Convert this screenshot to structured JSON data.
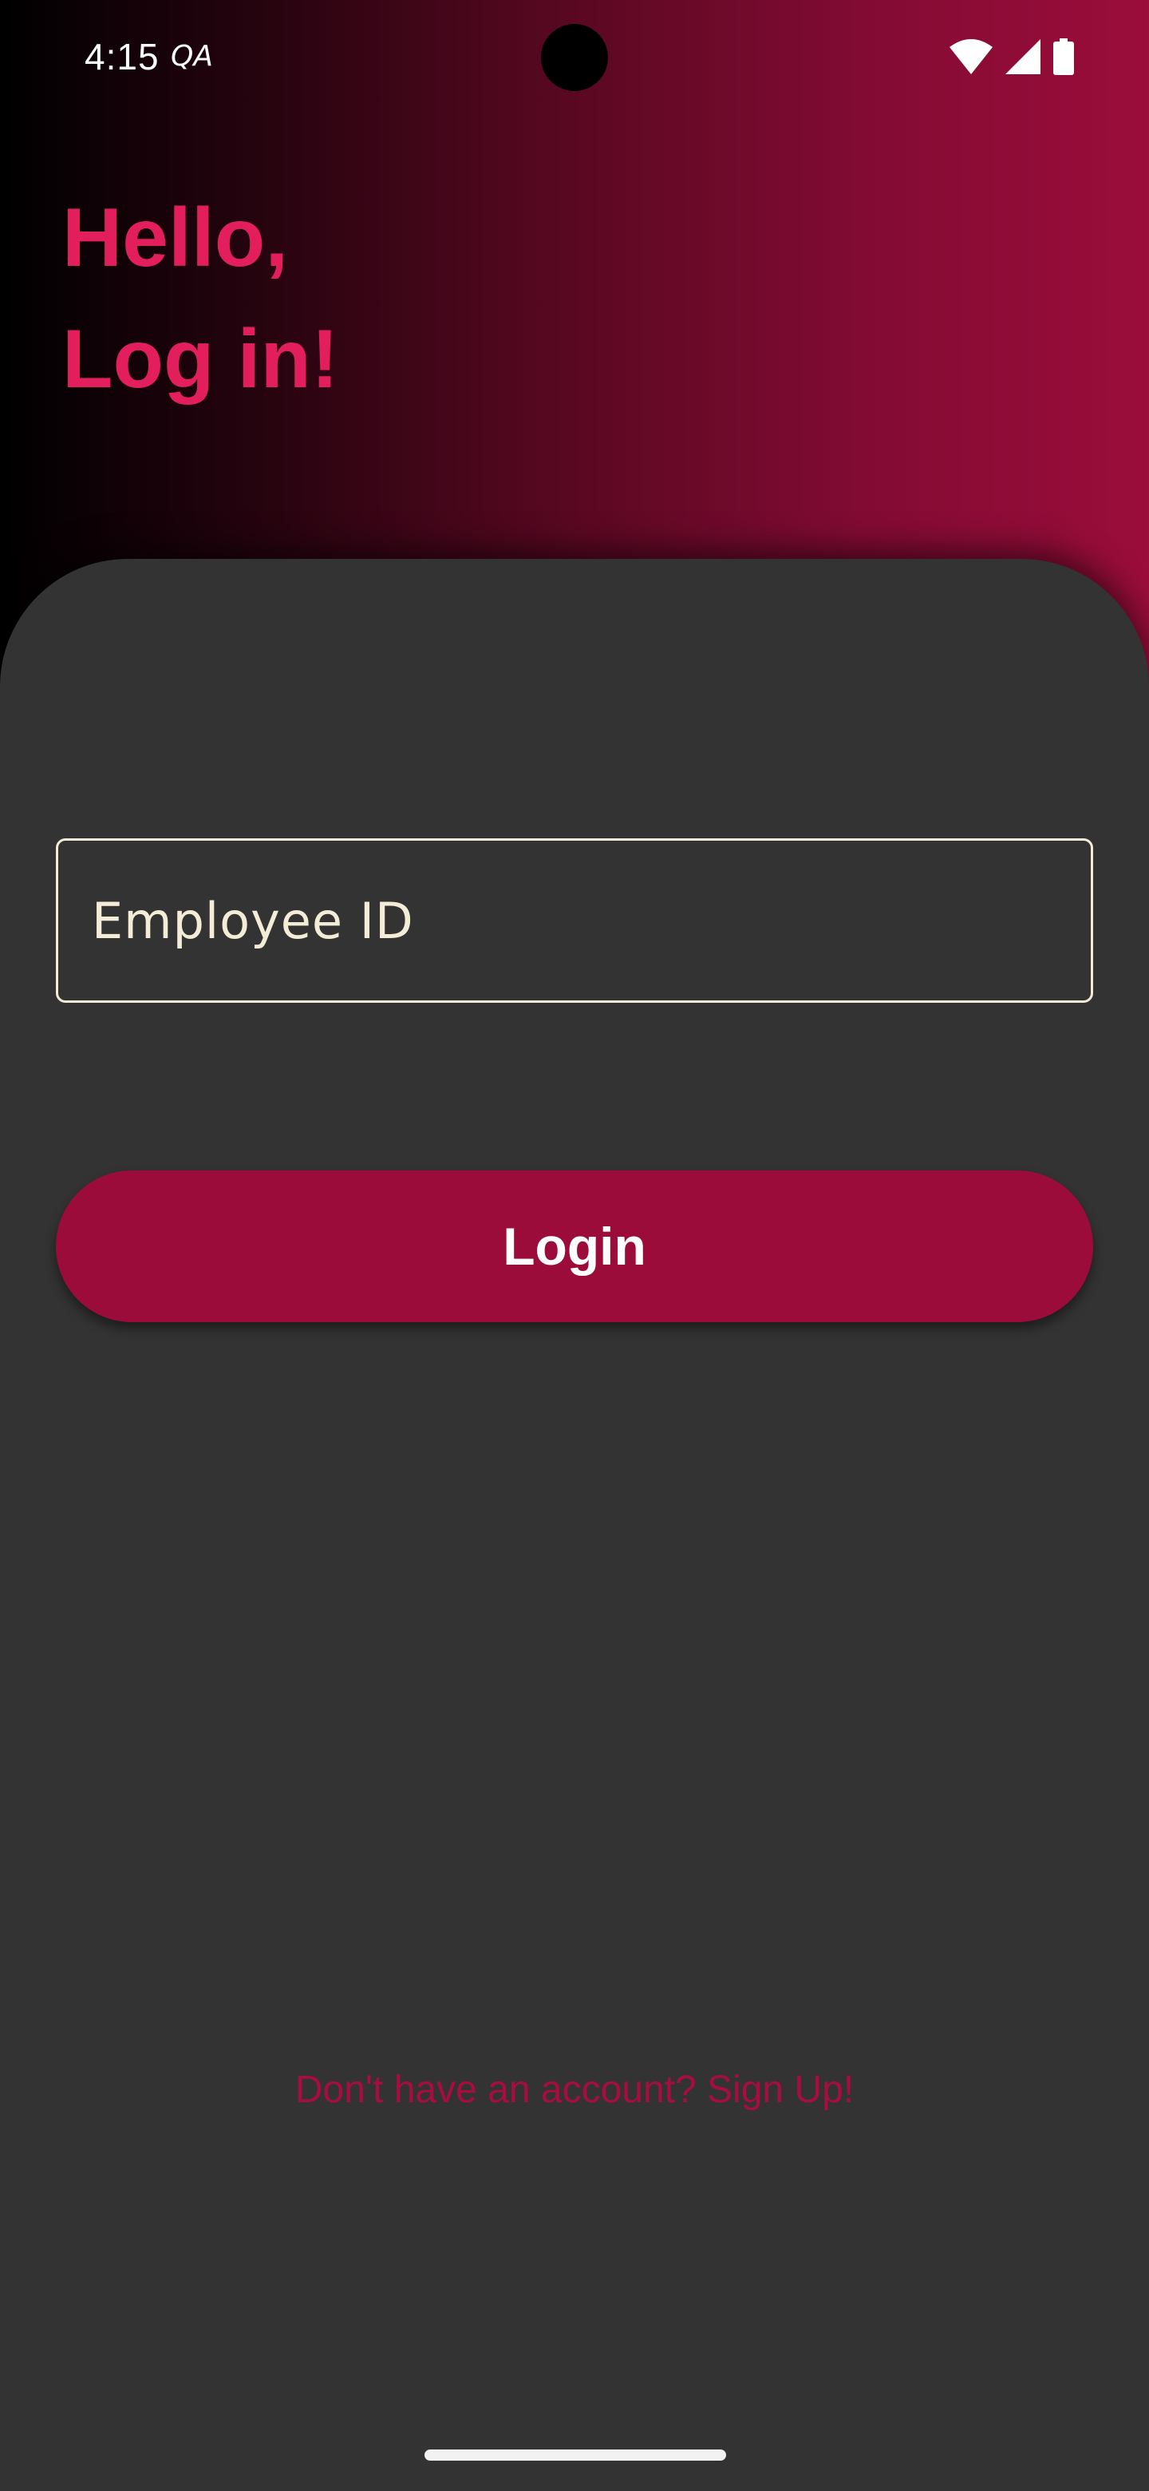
{
  "status_bar": {
    "time": "4:15",
    "indicator": "QA",
    "icons": [
      "wifi-icon",
      "cell-signal-icon",
      "battery-icon"
    ]
  },
  "header": {
    "line1": "Hello,",
    "line2": "Log in!"
  },
  "form": {
    "employee_id_placeholder": "Employee ID",
    "employee_id_value": "",
    "login_label": "Login"
  },
  "footer": {
    "signup_text": "Don't have an account? Sign Up!"
  },
  "colors": {
    "accent": "#e21f5c",
    "button": "#9b0c3a",
    "card": "#333333",
    "field_border": "#f3ecd6",
    "link": "#a70d3e"
  }
}
